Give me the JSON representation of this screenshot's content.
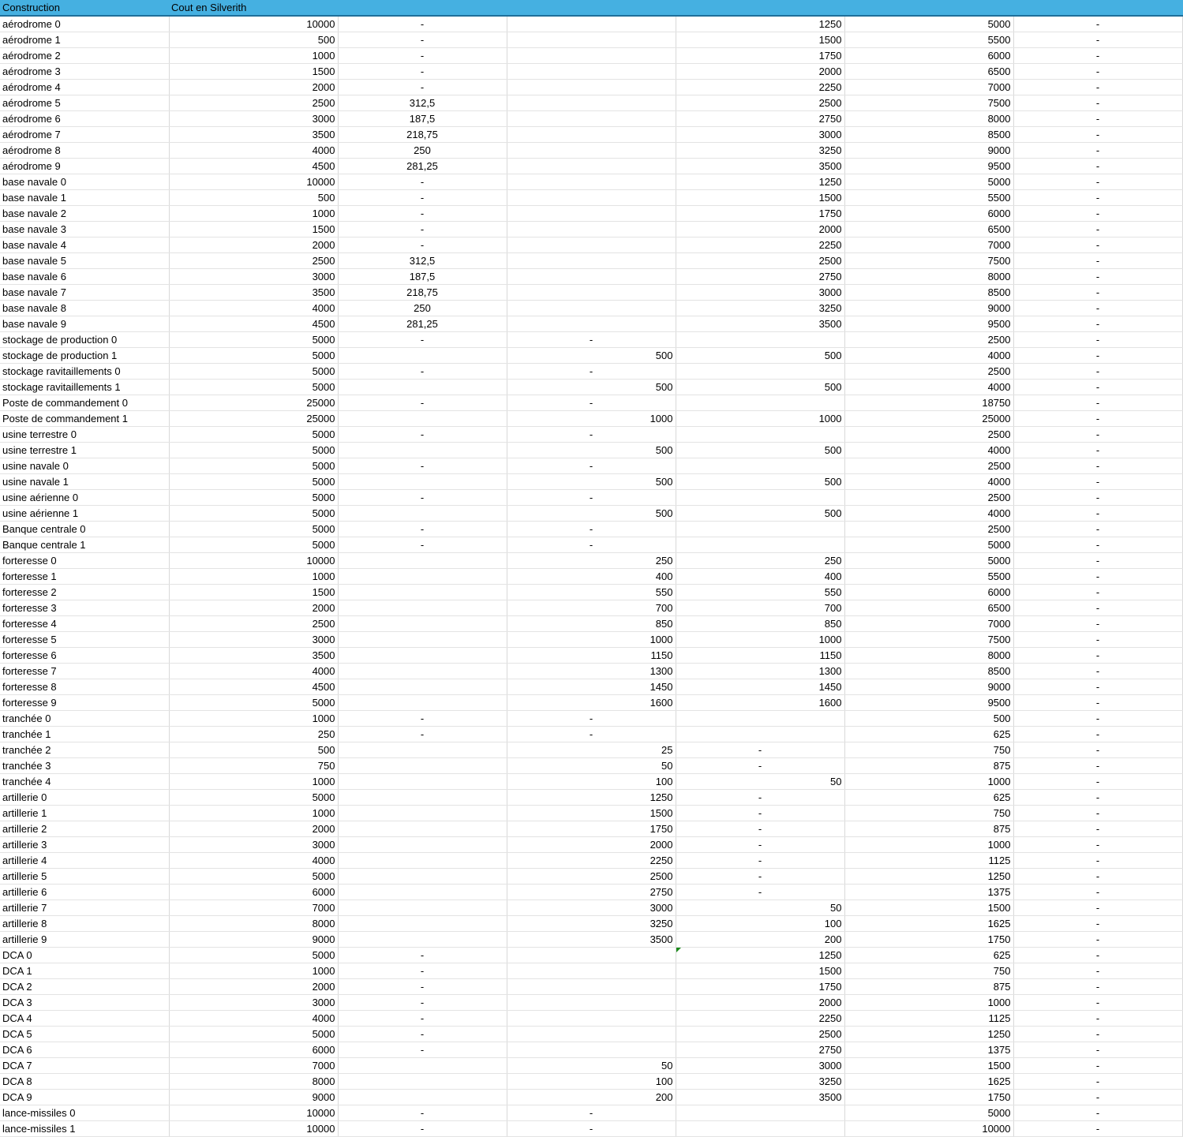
{
  "header": {
    "col_construction": "Construction",
    "col_cost": "Cout en Silverith",
    "col_3": "",
    "col_4": "",
    "col_5": "",
    "col_6": "",
    "col_7": ""
  },
  "rows": [
    [
      "aérodrome 0",
      "10000",
      "-",
      "",
      "1250",
      "5000",
      "-",
      "-"
    ],
    [
      "aérodrome 1",
      "500",
      "-",
      "",
      "1500",
      "5500",
      "-",
      "-"
    ],
    [
      "aérodrome 2",
      "1000",
      "-",
      "",
      "1750",
      "6000",
      "-",
      "-"
    ],
    [
      "aérodrome 3",
      "1500",
      "-",
      "",
      "2000",
      "6500",
      "-",
      "-"
    ],
    [
      "aérodrome 4",
      "2000",
      "-",
      "",
      "2250",
      "7000",
      "-",
      "-"
    ],
    [
      "aérodrome 5",
      "2500",
      "312,5",
      "",
      "2500",
      "7500",
      "-",
      "-"
    ],
    [
      "aérodrome 6",
      "3000",
      "187,5",
      "",
      "2750",
      "8000",
      "-",
      "-"
    ],
    [
      "aérodrome 7",
      "3500",
      "218,75",
      "",
      "3000",
      "8500",
      "-",
      "-"
    ],
    [
      "aérodrome 8",
      "4000",
      "250",
      "",
      "3250",
      "9000",
      "-",
      "-"
    ],
    [
      "aérodrome 9",
      "4500",
      "281,25",
      "",
      "3500",
      "9500",
      "-",
      "-"
    ],
    [
      "base navale 0",
      "10000",
      "-",
      "",
      "1250",
      "5000",
      "-",
      "-"
    ],
    [
      "base navale 1",
      "500",
      "-",
      "",
      "1500",
      "5500",
      "-",
      "-"
    ],
    [
      "base navale 2",
      "1000",
      "-",
      "",
      "1750",
      "6000",
      "-",
      "-"
    ],
    [
      "base navale 3",
      "1500",
      "-",
      "",
      "2000",
      "6500",
      "-",
      "-"
    ],
    [
      "base navale 4",
      "2000",
      "-",
      "",
      "2250",
      "7000",
      "-",
      "-"
    ],
    [
      "base navale 5",
      "2500",
      "312,5",
      "",
      "2500",
      "7500",
      "-",
      "-"
    ],
    [
      "base navale 6",
      "3000",
      "187,5",
      "",
      "2750",
      "8000",
      "-",
      "-"
    ],
    [
      "base navale 7",
      "3500",
      "218,75",
      "",
      "3000",
      "8500",
      "-",
      "-"
    ],
    [
      "base navale 8",
      "4000",
      "250",
      "",
      "3250",
      "9000",
      "-",
      "-"
    ],
    [
      "base navale 9",
      "4500",
      "281,25",
      "",
      "3500",
      "9500",
      "-",
      "-"
    ],
    [
      "stockage de production 0",
      "5000",
      "-",
      "-",
      "",
      "2500",
      "-",
      "-"
    ],
    [
      "stockage de production 1",
      "5000",
      "",
      "500",
      "500",
      "4000",
      "-",
      "-"
    ],
    [
      "stockage ravitaillements 0",
      "5000",
      "-",
      "-",
      "",
      "2500",
      "-",
      "-"
    ],
    [
      "stockage ravitaillements 1",
      "5000",
      "",
      "500",
      "500",
      "4000",
      "-",
      "-"
    ],
    [
      "Poste de commandement 0",
      "25000",
      "-",
      "-",
      "",
      "18750",
      "-",
      "-"
    ],
    [
      "Poste de commandement 1",
      "25000",
      "",
      "1000",
      "1000",
      "25000",
      "-",
      "-"
    ],
    [
      "usine terrestre 0",
      "5000",
      "-",
      "-",
      "",
      "2500",
      "-",
      "-"
    ],
    [
      "usine terrestre 1",
      "5000",
      "",
      "500",
      "500",
      "4000",
      "-",
      "-"
    ],
    [
      "usine navale 0",
      "5000",
      "-",
      "-",
      "",
      "2500",
      "-",
      "-"
    ],
    [
      "usine navale 1",
      "5000",
      "",
      "500",
      "500",
      "4000",
      "-",
      "-"
    ],
    [
      "usine aérienne 0",
      "5000",
      "-",
      "-",
      "",
      "2500",
      "-",
      "-"
    ],
    [
      "usine aérienne 1",
      "5000",
      "",
      "500",
      "500",
      "4000",
      "-",
      "-"
    ],
    [
      "Banque centrale 0",
      "5000",
      "-",
      "-",
      "",
      "2500",
      "-",
      "-"
    ],
    [
      "Banque centrale 1",
      "5000",
      "-",
      "-",
      "",
      "5000",
      "-",
      "-"
    ],
    [
      "forteresse 0",
      "10000",
      "",
      "250",
      "250",
      "5000",
      "-",
      "-"
    ],
    [
      "forteresse 1",
      "1000",
      "",
      "400",
      "400",
      "5500",
      "-",
      "-"
    ],
    [
      "forteresse 2",
      "1500",
      "",
      "550",
      "550",
      "6000",
      "-",
      "-"
    ],
    [
      "forteresse 3",
      "2000",
      "",
      "700",
      "700",
      "6500",
      "-",
      "-"
    ],
    [
      "forteresse 4",
      "2500",
      "",
      "850",
      "850",
      "7000",
      "-",
      "-"
    ],
    [
      "forteresse 5",
      "3000",
      "",
      "1000",
      "1000",
      "7500",
      "-",
      "-"
    ],
    [
      "forteresse 6",
      "3500",
      "",
      "1150",
      "1150",
      "8000",
      "-",
      "-"
    ],
    [
      "forteresse 7",
      "4000",
      "",
      "1300",
      "1300",
      "8500",
      "-",
      "-"
    ],
    [
      "forteresse 8",
      "4500",
      "",
      "1450",
      "1450",
      "9000",
      "-",
      "-"
    ],
    [
      "forteresse 9",
      "5000",
      "",
      "1600",
      "1600",
      "9500",
      "-",
      "-"
    ],
    [
      "tranchée 0",
      "1000",
      "-",
      "-",
      "",
      "500",
      "-",
      "-"
    ],
    [
      "tranchée 1",
      "250",
      "-",
      "-",
      "",
      "625",
      "-",
      "-"
    ],
    [
      "tranchée 2",
      "500",
      "",
      "25",
      "-",
      "750",
      "-",
      "-"
    ],
    [
      "tranchée 3",
      "750",
      "",
      "50",
      "-",
      "875",
      "-",
      "-"
    ],
    [
      "tranchée 4",
      "1000",
      "",
      "100",
      "50",
      "1000",
      "-",
      "-"
    ],
    [
      "artillerie 0",
      "5000",
      "",
      "1250",
      "-",
      "625",
      "-",
      "-"
    ],
    [
      "artillerie 1",
      "1000",
      "",
      "1500",
      "-",
      "750",
      "-",
      "-"
    ],
    [
      "artillerie 2",
      "2000",
      "",
      "1750",
      "-",
      "875",
      "-",
      "-"
    ],
    [
      "artillerie 3",
      "3000",
      "",
      "2000",
      "-",
      "1000",
      "-",
      "-"
    ],
    [
      "artillerie 4",
      "4000",
      "",
      "2250",
      "-",
      "1125",
      "-",
      "-"
    ],
    [
      "artillerie 5",
      "5000",
      "",
      "2500",
      "-",
      "1250",
      "-",
      "-"
    ],
    [
      "artillerie 6",
      "6000",
      "",
      "2750",
      "-",
      "1375",
      "-",
      "-"
    ],
    [
      "artillerie 7",
      "7000",
      "",
      "3000",
      "50",
      "1500",
      "-",
      "-"
    ],
    [
      "artillerie 8",
      "8000",
      "",
      "3250",
      "100",
      "1625",
      "-",
      "-"
    ],
    [
      "artillerie 9",
      "9000",
      "",
      "3500",
      "200",
      "1750",
      "-",
      "-"
    ],
    [
      "DCA 0",
      "5000",
      "-",
      "",
      "1250",
      "625",
      "-",
      "-"
    ],
    [
      "DCA 1",
      "1000",
      "-",
      "",
      "1500",
      "750",
      "-",
      "-"
    ],
    [
      "DCA 2",
      "2000",
      "-",
      "",
      "1750",
      "875",
      "-",
      "-"
    ],
    [
      "DCA 3",
      "3000",
      "-",
      "",
      "2000",
      "1000",
      "-",
      "-"
    ],
    [
      "DCA 4",
      "4000",
      "-",
      "",
      "2250",
      "1125",
      "-",
      "-"
    ],
    [
      "DCA 5",
      "5000",
      "-",
      "",
      "2500",
      "1250",
      "-",
      "-"
    ],
    [
      "DCA 6",
      "6000",
      "-",
      "",
      "2750",
      "1375",
      "-",
      "-"
    ],
    [
      "DCA 7",
      "7000",
      "",
      "50",
      "3000",
      "1500",
      "-",
      "-"
    ],
    [
      "DCA 8",
      "8000",
      "",
      "100",
      "3250",
      "1625",
      "-",
      "-"
    ],
    [
      "DCA 9",
      "9000",
      "",
      "200",
      "3500",
      "1750",
      "-",
      "-"
    ],
    [
      "lance-missiles 0",
      "10000",
      "-",
      "-",
      "",
      "5000",
      "-",
      "-"
    ],
    [
      "lance-missiles 1",
      "10000",
      "-",
      "-",
      "",
      "10000",
      "-",
      "-"
    ]
  ]
}
